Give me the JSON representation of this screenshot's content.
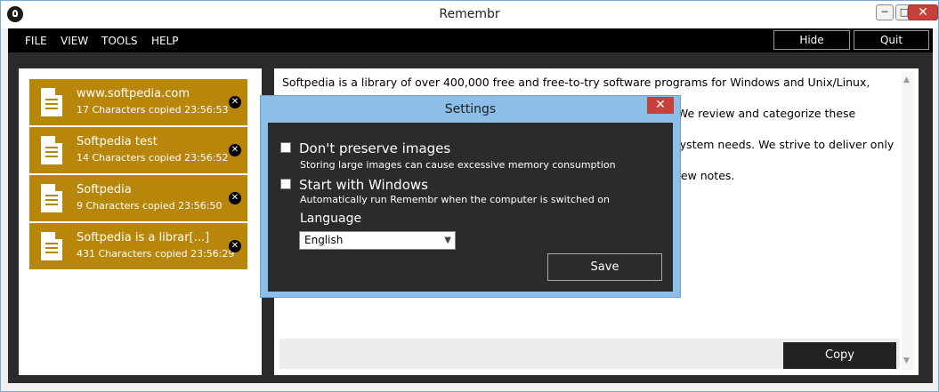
{
  "app": {
    "title": "Remembr"
  },
  "window_controls": {
    "minimize": "─",
    "maximize": "□",
    "close": "✕"
  },
  "menu": {
    "items": [
      "FILE",
      "VIEW",
      "TOOLS",
      "HELP"
    ],
    "hide_label": "Hide",
    "quit_label": "Quit"
  },
  "clips": [
    {
      "title": "www.softpedia.com",
      "meta": "17 Characters copied 23:56:53"
    },
    {
      "title": "Softpedia test",
      "meta": "14 Characters copied 23:56:52"
    },
    {
      "title": "Softpedia",
      "meta": "9 Characters copied 23:56:50"
    },
    {
      "title": "Softpedia is a librar[...]",
      "meta": "431 Characters copied 23:56:29"
    }
  ],
  "content": {
    "line1": "Softpedia is a library of over 400,000 free and free-to-try software programs for Windows and Unix/Linux, games,",
    "line2": "Mac software, Windows drivers, mobile devices and IT-related articles. We review and categorize these products in",
    "line3": "order to allow the visitor/user to find the exact product they and their system needs. We strive to deliver only the best",
    "line4": "products to the visitor/user together with self-made evaluation and review notes.",
    "copy_label": "Copy"
  },
  "settings_dialog": {
    "title": "Settings",
    "close_glyph": "✕",
    "options": [
      {
        "label": "Don't preserve images",
        "description": "Storing large images can cause excessive memory consumption",
        "checked": false
      },
      {
        "label": "Start with Windows",
        "description": "Automatically run Remembr when the computer is switched on",
        "checked": false
      }
    ],
    "language_label": "Language",
    "language_value": "English",
    "save_label": "Save"
  },
  "colors": {
    "accent_gold": "#b8860b",
    "dark_background": "#2b2b2b",
    "dialog_frame": "#8bbfe8",
    "close_red": "#c7403a"
  },
  "icons": {
    "app": "lightbulb-icon",
    "clip": "document-icon",
    "clip_remove": "close-circle-icon",
    "dropdown": "chevron-down-icon"
  }
}
